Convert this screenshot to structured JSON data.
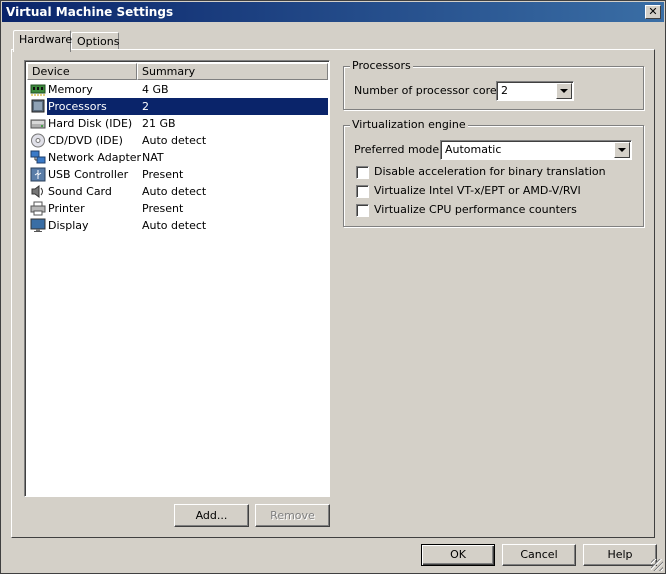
{
  "window": {
    "title": "Virtual Machine Settings",
    "close_glyph": "✕"
  },
  "tabs": [
    {
      "label": "Hardware",
      "active": true
    },
    {
      "label": "Options",
      "active": false
    }
  ],
  "device_list": {
    "columns": [
      "Device",
      "Summary"
    ],
    "rows": [
      {
        "device": "Memory",
        "summary": "4 GB",
        "icon": "memory-icon"
      },
      {
        "device": "Processors",
        "summary": "2",
        "icon": "processor-icon",
        "selected": true
      },
      {
        "device": "Hard Disk (IDE)",
        "summary": "21 GB",
        "icon": "hard-disk-icon"
      },
      {
        "device": "CD/DVD (IDE)",
        "summary": "Auto detect",
        "icon": "cd-dvd-icon"
      },
      {
        "device": "Network Adapter",
        "summary": "NAT",
        "icon": "network-adapter-icon"
      },
      {
        "device": "USB Controller",
        "summary": "Present",
        "icon": "usb-icon"
      },
      {
        "device": "Sound Card",
        "summary": "Auto detect",
        "icon": "sound-card-icon"
      },
      {
        "device": "Printer",
        "summary": "Present",
        "icon": "printer-icon"
      },
      {
        "device": "Display",
        "summary": "Auto detect",
        "icon": "display-icon"
      }
    ]
  },
  "list_buttons": {
    "add": "Add...",
    "remove": "Remove"
  },
  "processors": {
    "title": "Processors",
    "cores_label": "Number of processor cores:",
    "cores_value": "2"
  },
  "virtualization": {
    "title": "Virtualization engine",
    "mode_label": "Preferred mode:",
    "mode_value": "Automatic",
    "options": [
      {
        "label": "Disable acceleration for binary translation",
        "checked": false
      },
      {
        "label": "Virtualize Intel VT-x/EPT or AMD-V/RVI",
        "checked": false
      },
      {
        "label": "Virtualize CPU performance counters",
        "checked": false
      }
    ]
  },
  "dialog_buttons": {
    "ok": "OK",
    "cancel": "Cancel",
    "help": "Help"
  },
  "colors": {
    "selection": "#0a246a",
    "face": "#d4d0c8"
  }
}
